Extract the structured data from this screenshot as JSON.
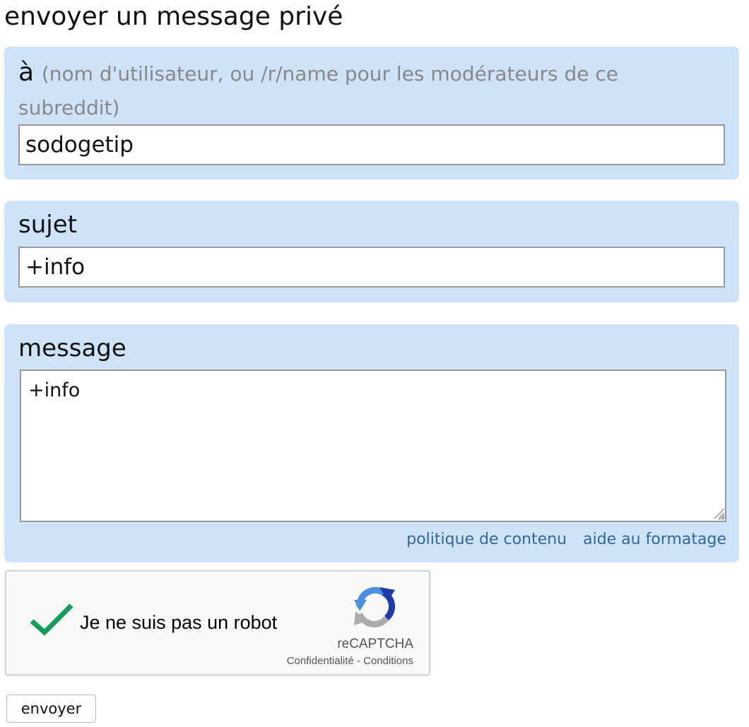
{
  "page": {
    "title": "envoyer un message privé"
  },
  "to_field": {
    "label": "à",
    "hint": "(nom d'utilisateur, ou /r/name pour les modérateurs de ce subreddit)",
    "value": "sodogetip"
  },
  "subject_field": {
    "label": "sujet",
    "value": "+info"
  },
  "message_field": {
    "label": "message",
    "value": "+info",
    "links": {
      "content_policy": "politique de contenu",
      "formatting_help": "aide au formatage"
    }
  },
  "recaptcha": {
    "label": "Je ne suis pas un robot",
    "checked": true,
    "brand": "reCAPTCHA",
    "privacy": "Confidentialité",
    "separator": " - ",
    "terms": "Conditions",
    "check_color": "#0f9d58"
  },
  "actions": {
    "submit_label": "envoyer"
  },
  "colors": {
    "field_background": "#cee3f8",
    "link": "#336699"
  }
}
